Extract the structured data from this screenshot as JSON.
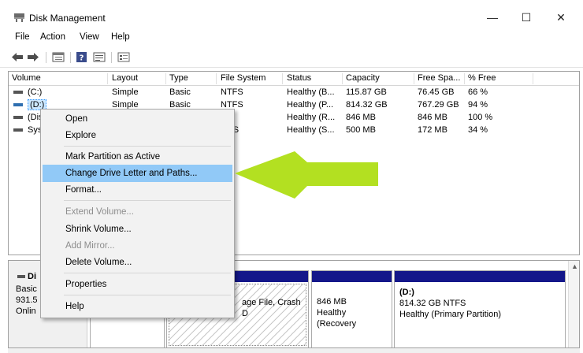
{
  "window": {
    "title": "Disk Management",
    "minimize": "—",
    "maximize": "☐",
    "close": "✕"
  },
  "menu": {
    "items": [
      "File",
      "Action",
      "View",
      "Help"
    ]
  },
  "columns": [
    "Volume",
    "Layout",
    "Type",
    "File System",
    "Status",
    "Capacity",
    "Free Spa...",
    "% Free"
  ],
  "volumes": [
    [
      "(C:)",
      "Simple",
      "Basic",
      "NTFS",
      "Healthy (B...",
      "115.87 GB",
      "76.45 GB",
      "66 %"
    ],
    [
      "(D:)",
      "Simple",
      "Basic",
      "NTFS",
      "Healthy (P...",
      "814.32 GB",
      "767.29 GB",
      "94 %"
    ],
    [
      "(Dis",
      "",
      "",
      "",
      "Healthy (R...",
      "846 MB",
      "846 MB",
      "100 %"
    ],
    [
      "Syst",
      "",
      "",
      "FS",
      "Healthy (S...",
      "500 MB",
      "172 MB",
      "34 %"
    ]
  ],
  "context_menu": {
    "items": [
      {
        "label": "Open",
        "disabled": false
      },
      {
        "label": "Explore",
        "disabled": false
      },
      {
        "label": "Mark Partition as Active",
        "disabled": false
      },
      {
        "label": "Change Drive Letter and Paths...",
        "disabled": false,
        "highlighted": true
      },
      {
        "label": "Format...",
        "disabled": false
      },
      {
        "label": "Extend Volume...",
        "disabled": true
      },
      {
        "label": "Shrink Volume...",
        "disabled": false
      },
      {
        "label": "Add Mirror...",
        "disabled": true
      },
      {
        "label": "Delete Volume...",
        "disabled": false
      },
      {
        "label": "Properties",
        "disabled": false
      },
      {
        "label": "Help",
        "disabled": false
      }
    ]
  },
  "disk": {
    "label_name": "Di",
    "label_type": "Basic",
    "label_size": "931.5",
    "label_status": "Onlin",
    "partitions": [
      {
        "line1": "",
        "line2": "age File, Crash D"
      },
      {
        "line1": "846 MB",
        "line2": "Healthy (Recovery"
      },
      {
        "line0": "(D:)",
        "line1": "814.32 GB NTFS",
        "line2": "Healthy (Primary Partition)"
      }
    ]
  },
  "colors": {
    "highlight": "#91c9f7",
    "arrow": "#b3e021",
    "partition_bar": "#14178a"
  }
}
